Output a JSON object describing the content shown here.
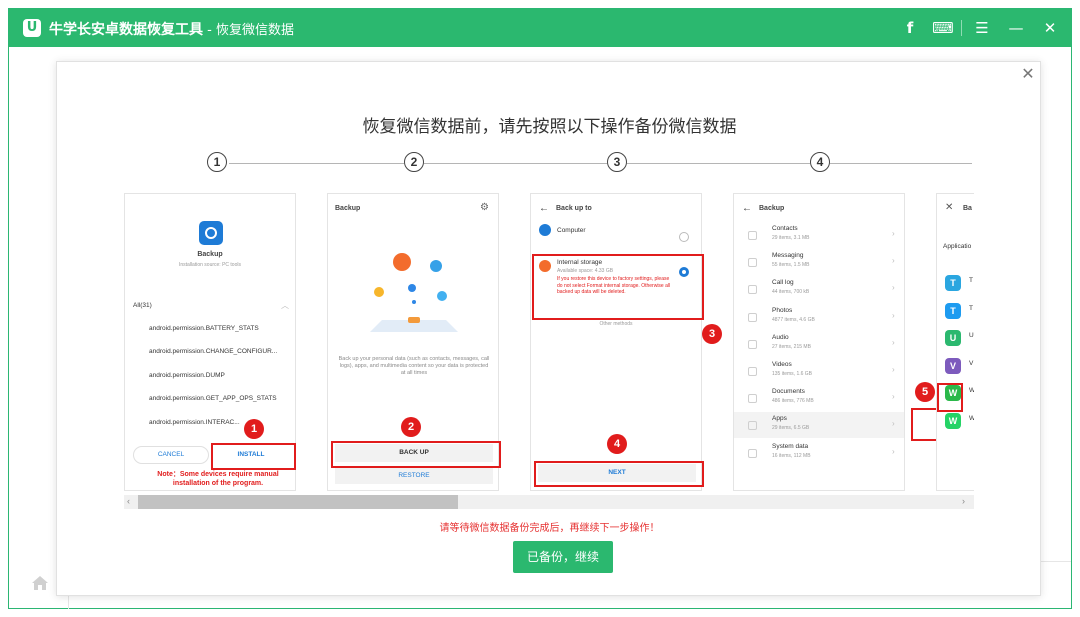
{
  "app": {
    "logo": "U",
    "title": "牛学长安卓数据恢复工具",
    "subtitle": " - 恢复微信数据"
  },
  "titlebar_icons": {
    "facebook": "f",
    "feedback": "⌨",
    "menu": "☰",
    "minimize": "—",
    "close": "✕"
  },
  "dialog": {
    "close": "✕",
    "heading": "恢复微信数据前，请先按照以下操作备份微信数据",
    "steps": [
      "1",
      "2",
      "3",
      "4"
    ],
    "warning": "请等待微信数据备份完成后，再继续下一步操作！",
    "continue_label": "已备份，继续"
  },
  "phone1": {
    "app_name": "Backup",
    "install_source": "Installation source: PC tools",
    "all_label": "All(31)",
    "permissions": [
      "android.permission.BATTERY_STATS",
      "android.permission.CHANGE_CONFIGUR...",
      "android.permission.DUMP",
      "android.permission.GET_APP_OPS_STATS",
      "android.permission.INTERAC..."
    ],
    "cancel": "CANCEL",
    "install": "INSTALL",
    "note": "Note：Some devices require manual installation of the program.",
    "badge": "1"
  },
  "phone2": {
    "header": "Backup",
    "description": "Back up your personal data (such as contacts, messages, call logs), apps, and multimedia content so your data is protected at all times",
    "backup_btn": "BACK UP",
    "restore_btn": "RESTORE",
    "badge": "2"
  },
  "phone3": {
    "header": "Back up to",
    "computer": "Computer",
    "internal_title": "Internal storage",
    "available": "Available space: 4.33 GB",
    "internal_desc": "If you restore this device to factory settings, please do not select Format internal storage. Otherwise all backed up data will be deleted.",
    "other_methods": "Other methods",
    "next": "NEXT",
    "badge3": "3",
    "badge4": "4"
  },
  "phone4": {
    "header": "Backup",
    "items": [
      {
        "name": "Contacts",
        "detail": "29 items, 3.1 MB"
      },
      {
        "name": "Messaging",
        "detail": "55 items, 1.5 MB"
      },
      {
        "name": "Call log",
        "detail": "44 items, 700 kB"
      },
      {
        "name": "Photos",
        "detail": "4877 items, 4.6 GB"
      },
      {
        "name": "Audio",
        "detail": "27 items, 215 MB"
      },
      {
        "name": "Videos",
        "detail": "135 items, 1.6 GB"
      },
      {
        "name": "Documents",
        "detail": "486 items, 776 MB"
      },
      {
        "name": "Apps",
        "detail": "29 items, 6.5 GB"
      },
      {
        "name": "System data",
        "detail": "16 items, 112 MB"
      }
    ],
    "badge": "5"
  },
  "phone5": {
    "header": "Ba",
    "section": "Applicatio",
    "apps": [
      {
        "letter": "T",
        "color": "#2aa6e0"
      },
      {
        "letter": "T",
        "color": "#1d9bf0"
      },
      {
        "letter": "U",
        "color": "#2bb86f"
      },
      {
        "letter": "V",
        "color": "#7d5bbd"
      },
      {
        "letter": "W",
        "color": "#2bb84a"
      },
      {
        "letter": "W",
        "color": "#25d366"
      }
    ]
  },
  "colors": {
    "brand": "#2bb86f",
    "highlight": "#e11c1c"
  }
}
